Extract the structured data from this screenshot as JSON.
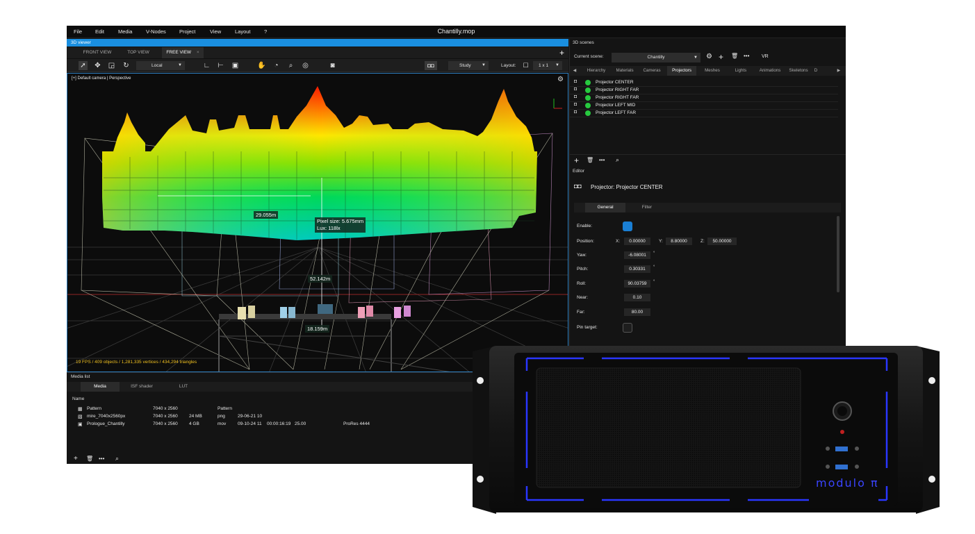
{
  "app": {
    "title": "Chantilly.mop",
    "menu": [
      "File",
      "Edit",
      "Media",
      "V-Nodes",
      "Project",
      "View",
      "Layout",
      "?"
    ]
  },
  "viewer": {
    "header": "3D viewer",
    "tabs": [
      "FRONT VIEW",
      "TOP VIEW",
      "FREE VIEW"
    ],
    "add_tab": "+",
    "close_tab": "×",
    "space_dropdown": "Local",
    "study_dropdown": "Study",
    "layout_label": "Layout:",
    "layout_dropdown": "1 x 1",
    "camera_label": "[+] Default camera | Perspective",
    "measure_1": "29.055m",
    "measure_2": "52.142m",
    "measure_3": "18.159m",
    "pixel_size": "Pixel size: 5.675mm",
    "lux": "Lux: 118lx",
    "stats": "19 FPS / 409 objects / 1,281,335 vertices / 434,294 triangles"
  },
  "media_list": {
    "header": "Media list",
    "tabs": [
      "Media",
      "ISF shader",
      "LUT"
    ],
    "column_name": "Name",
    "rows": [
      {
        "name": "Pattern",
        "res": "7040 x 2560",
        "size": "",
        "type": "Pattern",
        "date": "",
        "duration": "",
        "fps": "",
        "codec": ""
      },
      {
        "name": "mire_7040x2560px",
        "res": "7040 x 2560",
        "size": "24 MB",
        "type": "png",
        "date": "29-06-21 10",
        "duration": "",
        "fps": "",
        "codec": ""
      },
      {
        "name": "Prologue_Chantilly",
        "res": "7040 x 2560",
        "size": "4 GB",
        "type": "mov",
        "date": "09-10-24 11",
        "duration": "00:00:16:19",
        "fps": "25.00",
        "codec": "ProRes 4444"
      }
    ]
  },
  "scenes": {
    "header": "3D scenes",
    "current_label": "Current scene:",
    "current_value": "Chantilly",
    "vr": "VR",
    "tabs": [
      "Hierarchy",
      "Materials",
      "Cameras",
      "Projectors",
      "Meshes",
      "Lights",
      "Animations",
      "Skeletons",
      "D"
    ],
    "projectors": [
      "Projector CENTER",
      "Projector RIGHT FAR",
      "Projector RIGHT FAR",
      "Projector LEFT MID",
      "Projector LEFT FAR"
    ]
  },
  "editor": {
    "header": "Editor",
    "title": "Projector: Projector CENTER",
    "tabs": [
      "General",
      "Filter"
    ],
    "enable_label": "Enable:",
    "position_label": "Position:",
    "x_label": "X:",
    "x_value": "0.00000",
    "y_label": "Y:",
    "y_value": "8.80000",
    "z_label": "Z:",
    "z_value": "50.00000",
    "yaw_label": "Yaw:",
    "yaw_value": "-6.08001",
    "pitch_label": "Pitch:",
    "pitch_value": "0.30331",
    "roll_label": "Roll:",
    "roll_value": "90.03759",
    "deg": "°",
    "near_label": "Near:",
    "near_value": "0.10",
    "far_label": "Far:",
    "far_value": "80.00",
    "pin_label": "Pin target:",
    "enabled": true
  },
  "hardware": {
    "brand": "modulo π"
  },
  "colors": {
    "accent": "#1a8fe0",
    "status_on": "#27c93f",
    "fps_text": "#f0c020",
    "led": "#2a36ff"
  }
}
